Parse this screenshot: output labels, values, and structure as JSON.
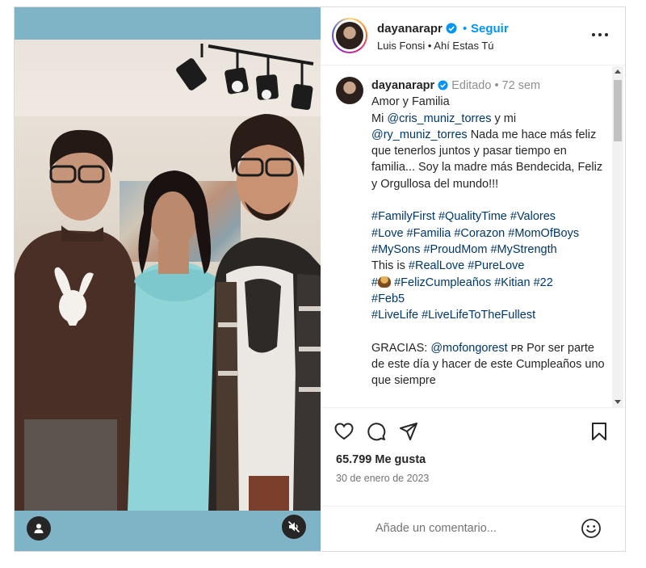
{
  "post": {
    "username": "dayanarapr",
    "follow_label": "Seguir",
    "dot": "•",
    "music": "Luis Fonsi • Ahí Estas Tú"
  },
  "caption": {
    "username": "dayanarapr",
    "edited": "Editado",
    "dot": "•",
    "age": "72 sem",
    "line1": "Amor y Familia",
    "mi1": "Mi ",
    "mention1": "@cris_muniz_torres",
    "ymi": " y mi",
    "mention2": "@ry_muniz_torres",
    "body": " Nada me hace más feliz que tenerlos juntos y pasar tiempo en familia... Soy la madre más Bendecida, Feliz y Orgullosa del mundo!!!",
    "tags_line1": "#FamilyFirst #QualityTime #Valores",
    "tags_line2": "#Love #Familia #Corazon #MomOfBoys",
    "tags_line3": "#MySons #ProudMom #MyStrength",
    "this_is": "This is ",
    "tags_line4": "#RealLove #PureLove",
    "hash_prefix": "#",
    "tags_line5": " #FelizCumpleaños #Kitian #22",
    "tags_line6": "#Feb5",
    "tags_line7": "#LiveLife #LiveLifeToTheFullest",
    "gracias": "GRACIAS: ",
    "mention3": "@mofongorest",
    "pr": " ᴘʀ",
    "gracias_body": " Por ser parte de este día y hacer de este Cumpleaños uno que siempre"
  },
  "actions": {
    "likes": "65.799 Me gusta",
    "date": "30 de enero de 2023"
  },
  "comment": {
    "placeholder": "Añade un comentario..."
  },
  "icons": {
    "like": "heart-icon",
    "comment": "speech-bubble-icon",
    "share": "paper-plane-icon",
    "save": "bookmark-icon",
    "more": "ellipsis-icon",
    "verified": "verified-badge-icon",
    "emoji": "smiley-icon",
    "tag_users": "user-tag-icon",
    "mute": "speaker-muted-icon"
  },
  "colors": {
    "link": "#00376b",
    "follow": "#0095f6",
    "verified": "#0095f6",
    "media_bg": "#7fb4c6"
  }
}
